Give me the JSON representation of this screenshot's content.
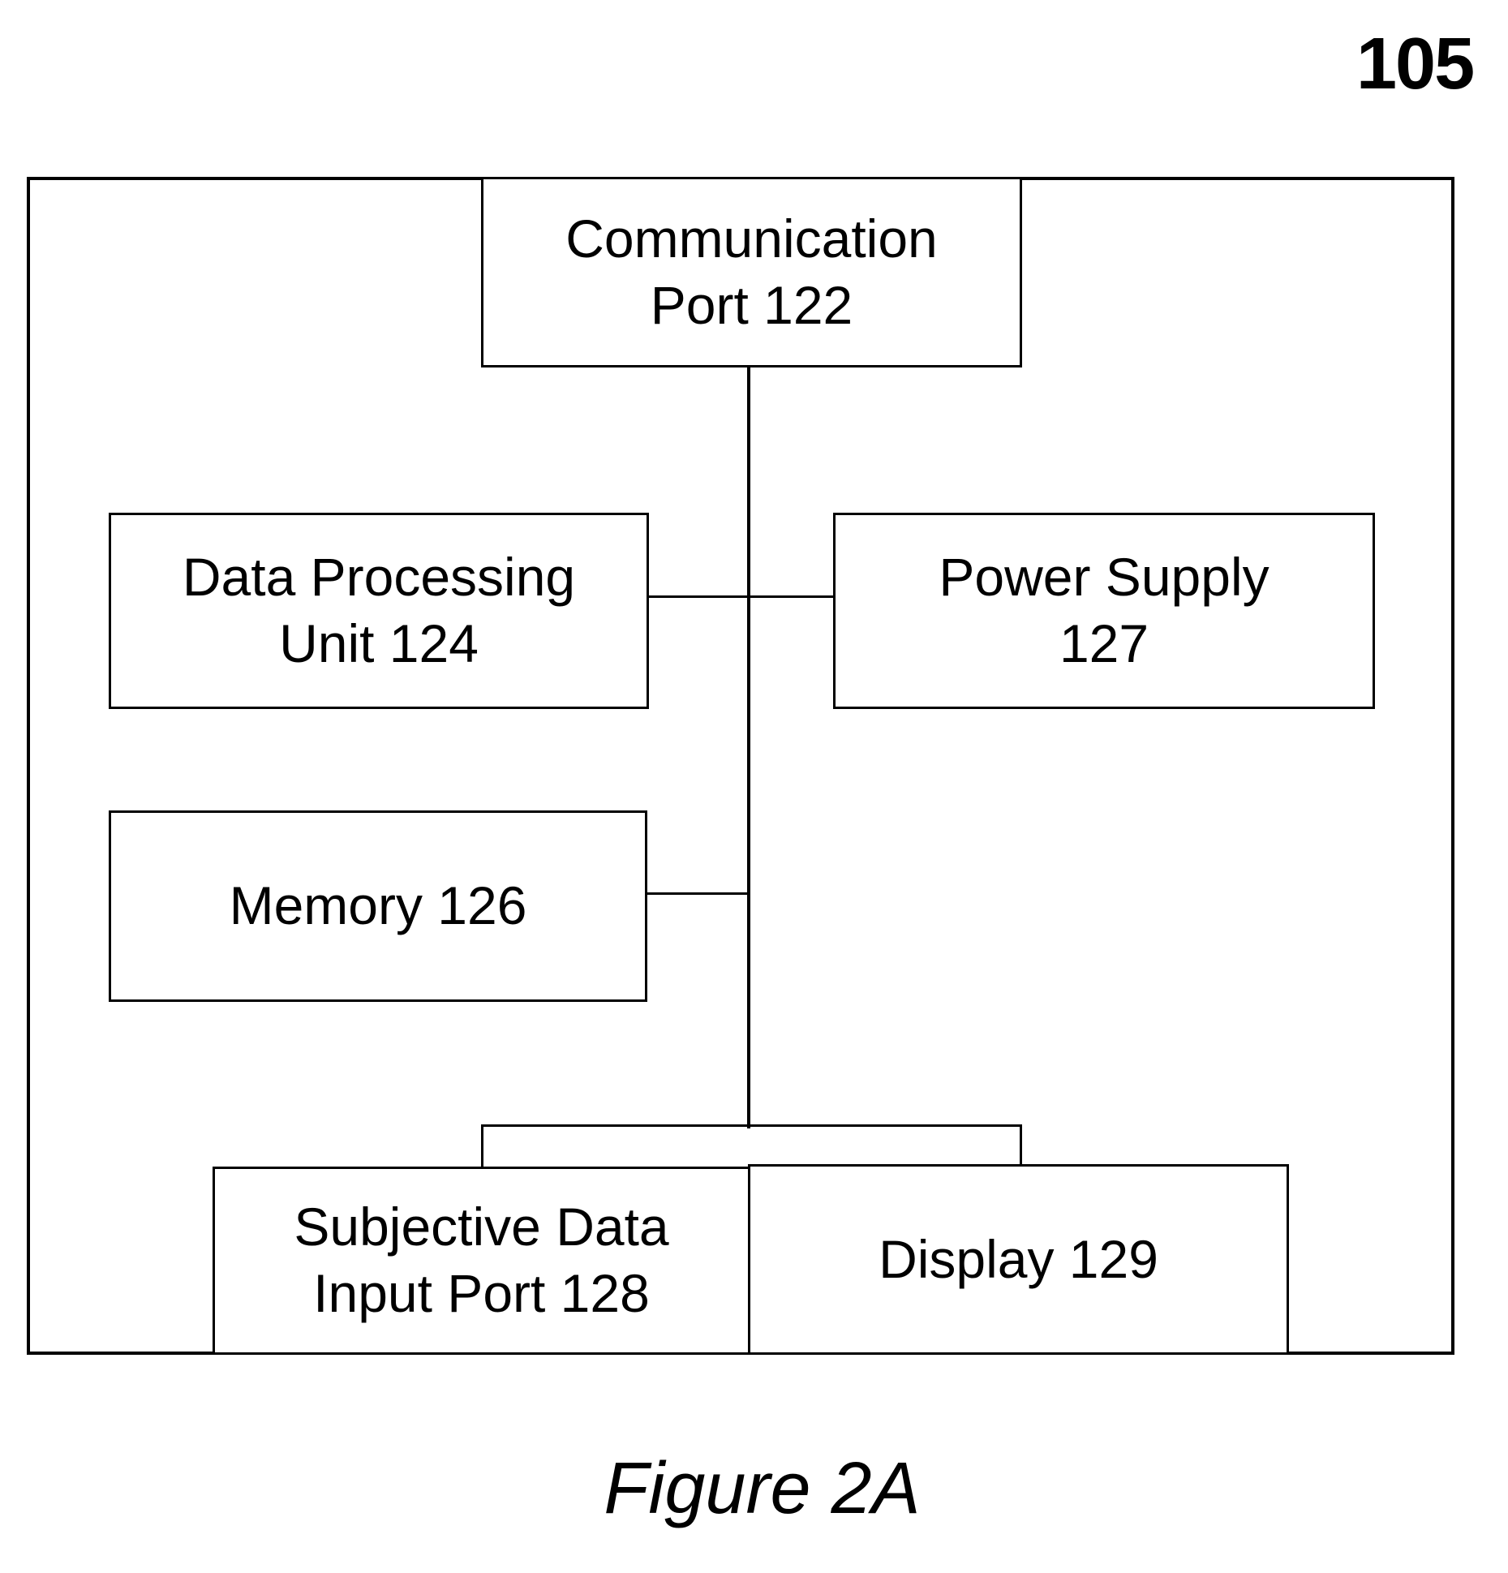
{
  "diagram": {
    "reference_number": "105",
    "caption": "Figure 2A",
    "blocks": {
      "communication_port": {
        "label": "Communication\nPort 122"
      },
      "data_processing_unit": {
        "label": "Data Processing\nUnit 124"
      },
      "power_supply": {
        "label": "Power Supply\n127"
      },
      "memory": {
        "label": "Memory 126"
      },
      "subjective_data_input_port": {
        "label": "Subjective Data\nInput Port 128"
      },
      "display": {
        "label": "Display 129"
      }
    },
    "connections": [
      [
        "Communication Port 122",
        "Data Processing Unit 124"
      ],
      [
        "Communication Port 122",
        "Power Supply 127"
      ],
      [
        "Communication Port 122",
        "Memory 126"
      ],
      [
        "Communication Port 122",
        "Subjective Data Input Port 128"
      ],
      [
        "Communication Port 122",
        "Display 129"
      ]
    ]
  }
}
